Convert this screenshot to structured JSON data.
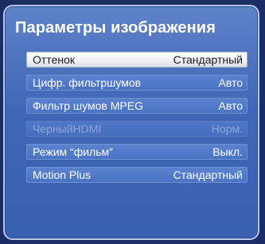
{
  "panel": {
    "title": "Параметры изображения"
  },
  "menu": {
    "items": [
      {
        "label": "Оттенок",
        "value": "Стандартный",
        "state": "selected"
      },
      {
        "label": "Цифр. фильтршумов",
        "value": "Авто",
        "state": "normal"
      },
      {
        "label": "Фильтр шумов MPEG",
        "value": "Авто",
        "state": "normal"
      },
      {
        "label": "ЧерныйHDMI",
        "value": "Норм.",
        "state": "disabled"
      },
      {
        "label": "Режим “фильм”",
        "value": "Выкл.",
        "state": "normal"
      },
      {
        "label": "Motion Plus",
        "value": "Стандартный",
        "state": "normal"
      }
    ]
  },
  "colors": {
    "background": "#1a2d64",
    "panel": "#3f67b6",
    "selected_item": "#f1f3f6",
    "disabled_text": "#8fa5d6"
  }
}
